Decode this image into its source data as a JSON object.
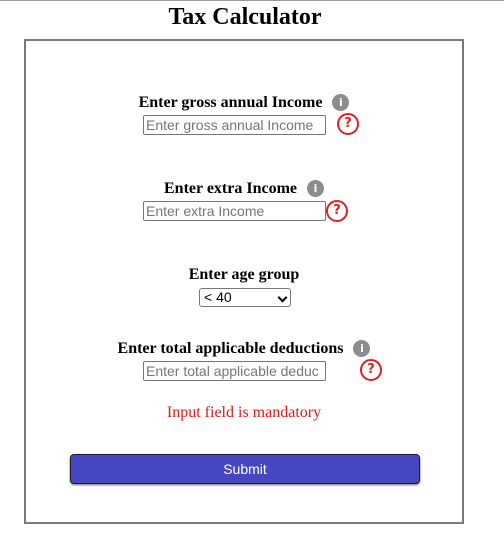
{
  "title": "Tax Calculator",
  "fields": {
    "gross_income": {
      "label": "Enter gross annual Income",
      "placeholder": "Enter gross annual Income",
      "info_icon": "info-icon",
      "help_icon": "question-icon"
    },
    "extra_income": {
      "label": "Enter extra Income",
      "placeholder": "Enter extra Income",
      "info_icon": "info-icon",
      "help_icon": "question-icon"
    },
    "age_group": {
      "label": "Enter age group",
      "selected": "< 40"
    },
    "deductions": {
      "label": "Enter total applicable deductions",
      "placeholder": "Enter total applicable deduc",
      "info_icon": "info-icon",
      "help_icon": "question-icon"
    }
  },
  "error_message": "Input field is mandatory",
  "submit_label": "Submit",
  "glyphs": {
    "info": "i",
    "help": "?"
  },
  "colors": {
    "submit_bg": "#4747c2",
    "error": "#e01b1b",
    "help_icon": "#e02020"
  }
}
